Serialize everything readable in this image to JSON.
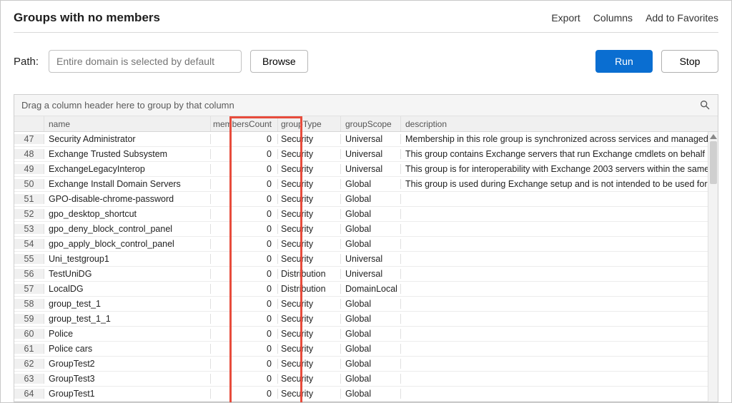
{
  "title": "Groups with no members",
  "header_actions": {
    "export": "Export",
    "columns": "Columns",
    "favorites": "Add to Favorites"
  },
  "path": {
    "label": "Path:",
    "placeholder": "Entire domain is selected by default",
    "browse": "Browse"
  },
  "buttons": {
    "run": "Run",
    "stop": "Stop"
  },
  "grid": {
    "group_hint": "Drag a column header here to group by that column",
    "columns": {
      "name": "name",
      "membersCount": "membersCount",
      "groupType": "groupType",
      "groupScope": "groupScope",
      "description": "description"
    },
    "rows": [
      {
        "n": "47",
        "name": "Security Administrator",
        "mc": "0",
        "type": "Security",
        "scope": "Universal",
        "desc": "Membership in this role group is synchronized across services and managed centrally. Th"
      },
      {
        "n": "48",
        "name": "Exchange Trusted Subsystem",
        "mc": "0",
        "type": "Security",
        "scope": "Universal",
        "desc": "This group contains Exchange servers that run Exchange cmdlets on behalf of users via "
      },
      {
        "n": "49",
        "name": "ExchangeLegacyInterop",
        "mc": "0",
        "type": "Security",
        "scope": "Universal",
        "desc": "This group is for interoperability with Exchange 2003 servers within the same forest. Thi"
      },
      {
        "n": "50",
        "name": "Exchange Install Domain Servers",
        "mc": "0",
        "type": "Security",
        "scope": "Global",
        "desc": "This group is used during Exchange setup and is not intended to be used for other purpo"
      },
      {
        "n": "51",
        "name": "GPO-disable-chrome-password",
        "mc": "0",
        "type": "Security",
        "scope": "Global",
        "desc": ""
      },
      {
        "n": "52",
        "name": "gpo_desktop_shortcut",
        "mc": "0",
        "type": "Security",
        "scope": "Global",
        "desc": ""
      },
      {
        "n": "53",
        "name": "gpo_deny_block_control_panel",
        "mc": "0",
        "type": "Security",
        "scope": "Global",
        "desc": ""
      },
      {
        "n": "54",
        "name": "gpo_apply_block_control_panel",
        "mc": "0",
        "type": "Security",
        "scope": "Global",
        "desc": ""
      },
      {
        "n": "55",
        "name": "Uni_testgroup1",
        "mc": "0",
        "type": "Security",
        "scope": "Universal",
        "desc": ""
      },
      {
        "n": "56",
        "name": "TestUniDG",
        "mc": "0",
        "type": "Distribution",
        "scope": "Universal",
        "desc": ""
      },
      {
        "n": "57",
        "name": "LocalDG",
        "mc": "0",
        "type": "Distribution",
        "scope": "DomainLocal",
        "desc": ""
      },
      {
        "n": "58",
        "name": "group_test_1",
        "mc": "0",
        "type": "Security",
        "scope": "Global",
        "desc": ""
      },
      {
        "n": "59",
        "name": "group_test_1_1",
        "mc": "0",
        "type": "Security",
        "scope": "Global",
        "desc": ""
      },
      {
        "n": "60",
        "name": "Police",
        "mc": "0",
        "type": "Security",
        "scope": "Global",
        "desc": ""
      },
      {
        "n": "61",
        "name": "Police cars",
        "mc": "0",
        "type": "Security",
        "scope": "Global",
        "desc": ""
      },
      {
        "n": "62",
        "name": "GroupTest2",
        "mc": "0",
        "type": "Security",
        "scope": "Global",
        "desc": ""
      },
      {
        "n": "63",
        "name": "GroupTest3",
        "mc": "0",
        "type": "Security",
        "scope": "Global",
        "desc": ""
      },
      {
        "n": "64",
        "name": "GroupTest1",
        "mc": "0",
        "type": "Security",
        "scope": "Global",
        "desc": ""
      }
    ]
  }
}
